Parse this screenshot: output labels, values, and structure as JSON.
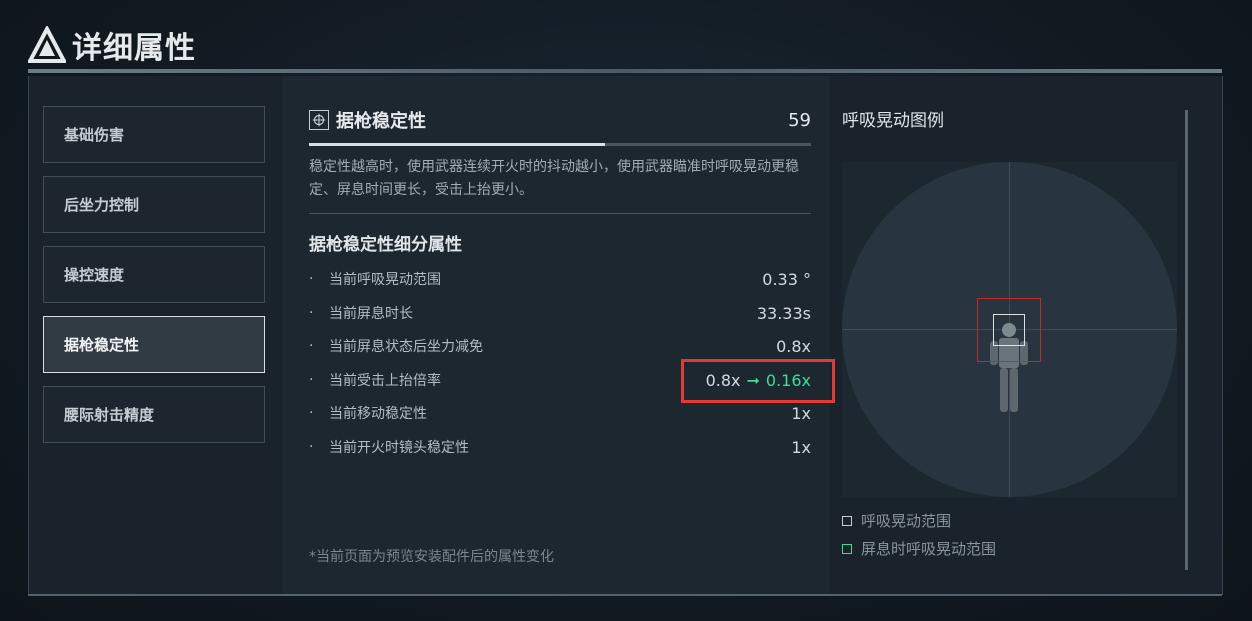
{
  "header": {
    "title": "详细属性"
  },
  "sidebar": {
    "items": [
      {
        "label": "基础伤害"
      },
      {
        "label": "后坐力控制"
      },
      {
        "label": "操控速度"
      },
      {
        "label": "据枪稳定性",
        "active": true
      },
      {
        "label": "腰际射击精度"
      }
    ]
  },
  "stat": {
    "name": "据枪稳定性",
    "value": "59",
    "progress": 0.59,
    "description": "稳定性越高时，使用武器连续开火时的抖动越小，使用武器瞄准时呼吸晃动更稳定、屏息时间更长，受击上抬更小。"
  },
  "breakdown": {
    "title": "据枪稳定性细分属性",
    "rows": [
      {
        "label": "当前呼吸晃动范围",
        "value": "0.33 °"
      },
      {
        "label": "当前屏息时长",
        "value": "33.33s"
      },
      {
        "label": "当前屏息状态后坐力减免",
        "value": "0.8x"
      },
      {
        "label": "当前受击上抬倍率",
        "value": "0.8x",
        "arrow": "➞",
        "new_value": "0.16x"
      },
      {
        "label": "当前移动稳定性",
        "value": "1x"
      },
      {
        "label": "当前开火时镜头稳定性",
        "value": "1x"
      }
    ],
    "bullet": "·"
  },
  "note": "*当前页面为预览安装配件后的属性变化",
  "legend": {
    "title": "呼吸晃动图例",
    "items": [
      {
        "label": "呼吸晃动范围",
        "color": "#c8cdd1"
      },
      {
        "label": "屏息时呼吸晃动范围",
        "color": "#3ddc97"
      }
    ]
  },
  "colors": {
    "accent_new_value": "#3ddc97",
    "highlight_border": "#e53935"
  }
}
